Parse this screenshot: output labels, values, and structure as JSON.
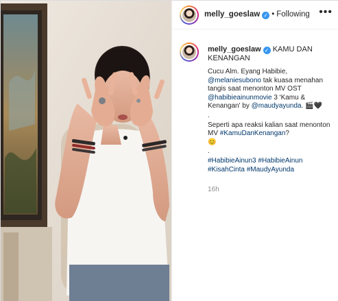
{
  "post": {
    "username": "melly_goeslaw",
    "follow_label": "Following",
    "separator": "•",
    "more_label": "•••",
    "title": "KAMU DAN KENANGAN",
    "verified_glyph": "✓",
    "caption_lines": [
      {
        "text": "Cucu Alm. Eyang Habibie,",
        "kind": "text"
      },
      {
        "text": "@melaniesubono",
        "kind": "mention"
      },
      {
        "text": " tak kuasa menahan tangis saat menonton MV OST ",
        "kind": "text"
      },
      {
        "text": "@habibieainunmovie",
        "kind": "mention"
      },
      {
        "text": " 3 'Kamu & Kenangan' by ",
        "kind": "text"
      },
      {
        "text": "@maudyayunda",
        "kind": "mention"
      },
      {
        "text": ". 🎬🖤",
        "kind": "text"
      }
    ],
    "dot_line": ".",
    "question": "Seperti apa reaksi kalian saat menonton MV ",
    "question_tag": "#KamuDanKenangan",
    "question_end": "?",
    "question_emoji": "😊",
    "dot_line2": ".",
    "hashtags": "#HabibieAinun3 #HabibieAinun #KisahCinta #MaudyAyunda",
    "time": "16h"
  },
  "colors": {
    "link": "#00376b",
    "verified": "#3897f0",
    "muted": "#8e8e8e"
  }
}
